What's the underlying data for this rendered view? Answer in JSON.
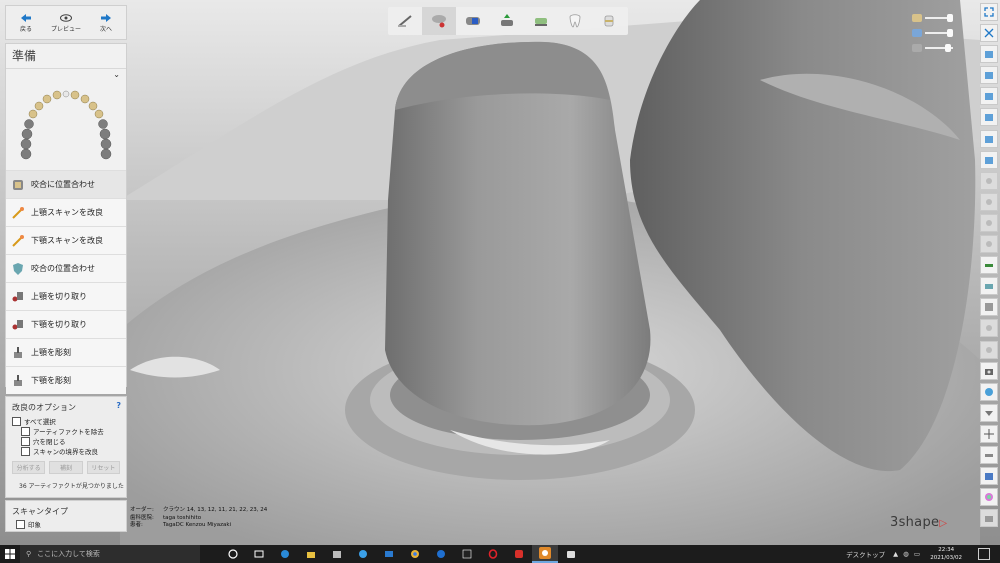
{
  "nav": {
    "back_label": "戻る",
    "preview_label": "プレビュー",
    "next_label": "次へ"
  },
  "prep": {
    "title": "準備",
    "steps": [
      {
        "label": "咬合に位置合わせ"
      },
      {
        "label": "上顎スキャンを改良"
      },
      {
        "label": "下顎スキャンを改良"
      },
      {
        "label": "咬合の位置合わせ"
      },
      {
        "label": "上顎を切り取り"
      },
      {
        "label": "下顎を切り取り"
      },
      {
        "label": "上顎を彫刻"
      },
      {
        "label": "下顎を彫刻"
      }
    ]
  },
  "options": {
    "title": "改良のオプション",
    "help": "?",
    "select_all": "すべて選択",
    "remove_artifacts": "アーティファクトを除去",
    "close_holes": "穴を閉じる",
    "improve_scan_border": "スキャンの境界を改良",
    "analyze_button": "分析する",
    "fix_button": "補刻",
    "reset_button": "リセット",
    "artifact_message": "36 アーティファクトが見つかりました"
  },
  "scan_type": {
    "title": "スキャンタイプ",
    "impression": "印象"
  },
  "order": {
    "order_key": "オーダー:",
    "order_value": "クラウン 14, 13, 12, 11, 21, 22, 23, 24",
    "clinic_key": "歯科医院:",
    "clinic_value": "taga toshihito",
    "patient_key": "患者:",
    "patient_value": "TagaDC Kenzou Miyazaki"
  },
  "logo": {
    "text": "3shape"
  },
  "taskbar": {
    "search_placeholder": "ここに入力して検索",
    "desktop_label": "デスクトップ",
    "time": "22:34",
    "date": "2021/03/02"
  },
  "colors": {
    "accent_blue": "#1f78c8",
    "logo_red": "#d63a3a",
    "taskbar": "#1c1c1c"
  }
}
